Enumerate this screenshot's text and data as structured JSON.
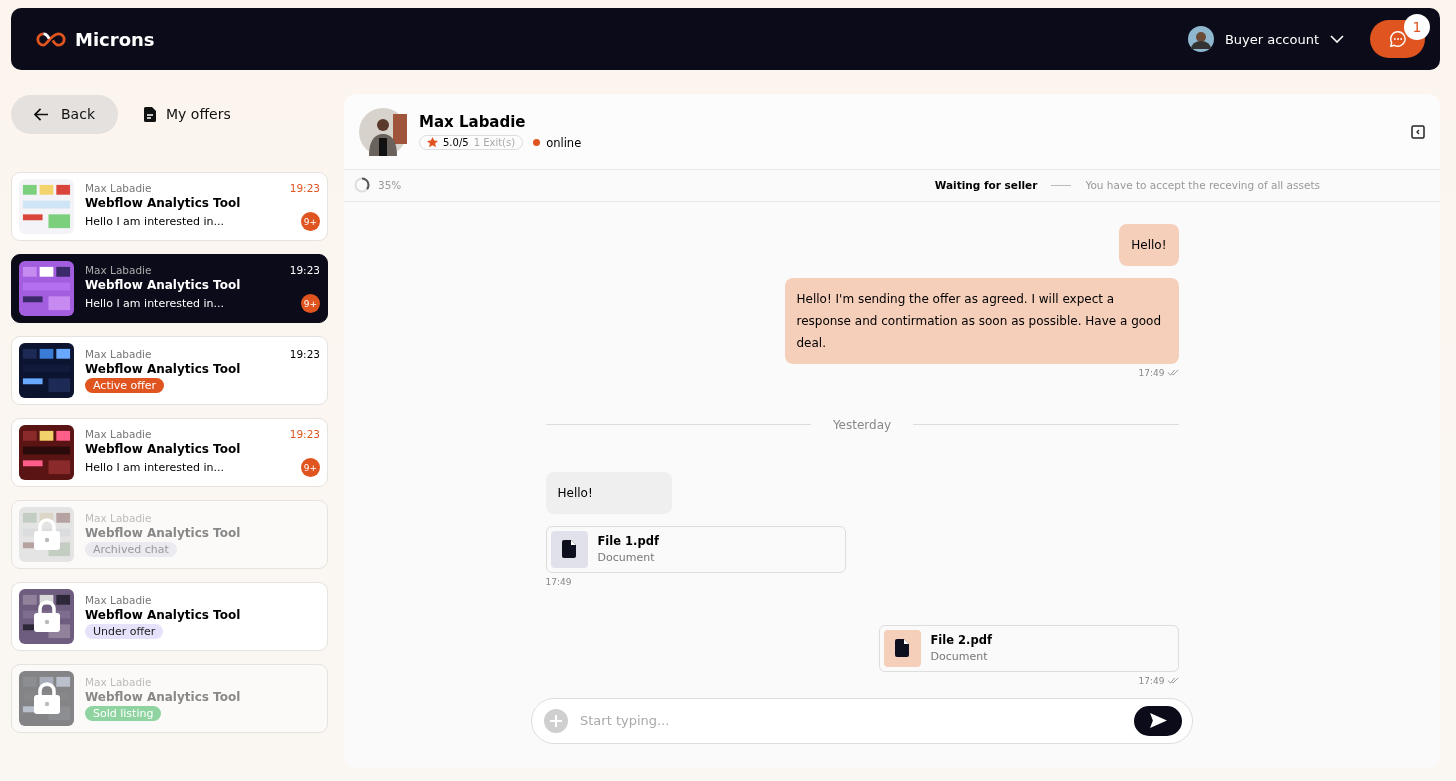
{
  "brand": "Microns",
  "account": {
    "label": "Buyer account"
  },
  "chat_button": {
    "badge": "1"
  },
  "nav": {
    "back": "Back",
    "offers": "My offers"
  },
  "conversations": [
    {
      "name": "Max Labadie",
      "title": "Webflow Analytics Tool",
      "preview": "Hello I am interested in...",
      "time": "19:23",
      "time_highlight": true,
      "badge": "9+",
      "selected": false,
      "locked": false,
      "disabled": false
    },
    {
      "name": "Max Labadie",
      "title": "Webflow Analytics Tool",
      "preview": "Hello I am interested in...",
      "time": "19:23",
      "time_highlight": false,
      "badge": "9+",
      "selected": true,
      "locked": false,
      "disabled": false
    },
    {
      "name": "Max Labadie",
      "title": "Webflow Analytics Tool",
      "tag": {
        "text": "Active offer",
        "color": "#e0541f"
      },
      "time": "19:23",
      "time_highlight": false,
      "selected": false,
      "locked": false,
      "disabled": false
    },
    {
      "name": "Max Labadie",
      "title": "Webflow Analytics Tool",
      "preview": "Hello I am interested in...",
      "time": "19:23",
      "time_highlight": true,
      "badge": "9+",
      "selected": false,
      "locked": false,
      "disabled": false
    },
    {
      "name": "Max Labadie",
      "title": "Webflow Analytics Tool",
      "tag": {
        "text": "Archived chat",
        "color": "#ebeaf0"
      },
      "selected": false,
      "locked": true,
      "disabled": true
    },
    {
      "name": "Max Labadie",
      "title": "Webflow Analytics Tool",
      "tag": {
        "text": "Under offer",
        "color": "#e6e2fb"
      },
      "selected": false,
      "locked": true,
      "disabled": false
    },
    {
      "name": "Max Labadie",
      "title": "Webflow Analytics Tool",
      "tag": {
        "text": "Sold listing",
        "color": "#8fd4a0"
      },
      "selected": false,
      "locked": true,
      "disabled": true
    }
  ],
  "contact": {
    "name": "Max Labadie",
    "rating": "5.0/5",
    "exits": "1 Exit(s)",
    "status": "online",
    "online": true
  },
  "progress": {
    "reading": "35%",
    "step": "Waiting for seller",
    "note": "You have to accept the receving of all assets"
  },
  "messages": [
    {
      "kind": "text",
      "outgoing": true,
      "text": "Hello!"
    },
    {
      "kind": "text",
      "outgoing": true,
      "text": "Hello! I'm sending the offer as agreed. I will expect a response and contirmation as soon as possible. Have a good deal.",
      "time": "17:49",
      "read": true
    },
    {
      "kind": "divider",
      "text": "Yesterday"
    },
    {
      "kind": "text",
      "outgoing": false,
      "text": "Hello!"
    },
    {
      "kind": "file",
      "outgoing": false,
      "file": "File 1.pdf",
      "type": "Document",
      "time": "17:49",
      "read": false
    },
    {
      "kind": "file",
      "outgoing": true,
      "file": "File 2.pdf",
      "type": "Document",
      "time": "17:49",
      "read": true
    }
  ],
  "composer": {
    "placeholder": "Start typing..."
  }
}
